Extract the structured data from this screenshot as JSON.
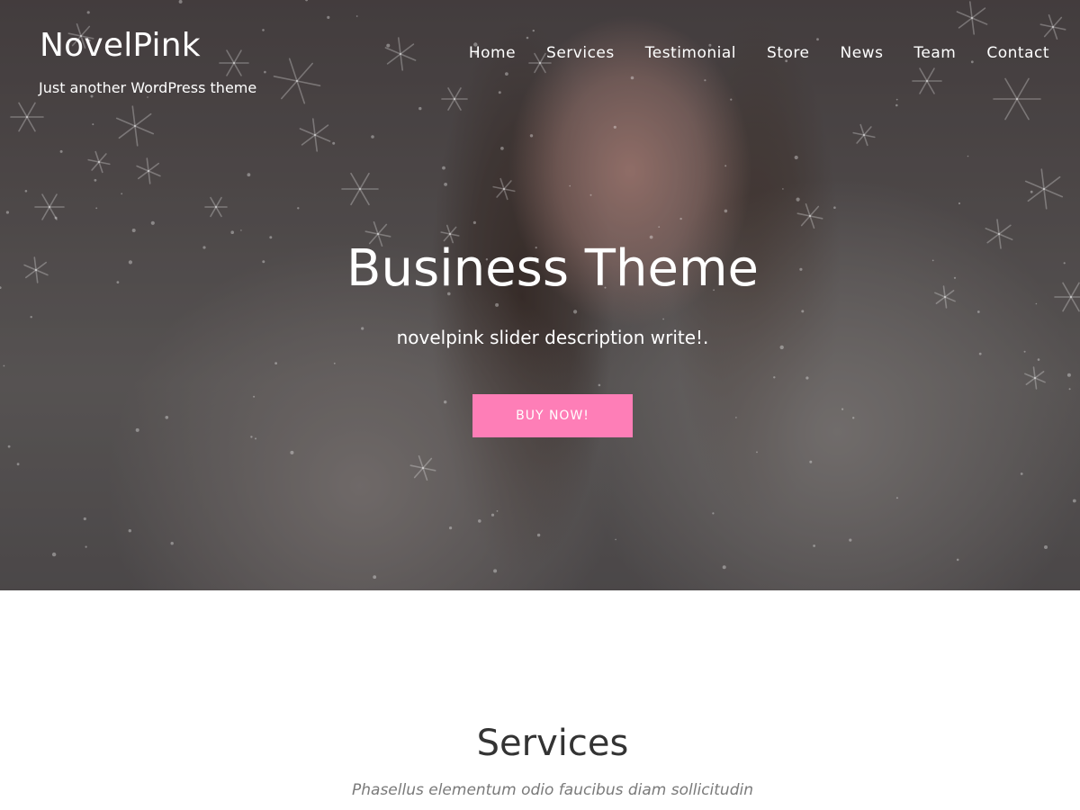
{
  "site": {
    "title": "NovelPink",
    "tagline": "Just another WordPress theme"
  },
  "nav": {
    "items": [
      {
        "label": "Home"
      },
      {
        "label": "Services"
      },
      {
        "label": "Testimonial"
      },
      {
        "label": "Store"
      },
      {
        "label": "News"
      },
      {
        "label": "Team"
      },
      {
        "label": "Contact"
      }
    ]
  },
  "hero": {
    "title": "Business Theme",
    "description": "novelpink slider description write!.",
    "button_label": "BUY NOW!",
    "button_color": "#fe7eb7",
    "image": "smiling woman in white fur coat with snowflakes"
  },
  "services": {
    "title": "Services",
    "subtitle": "Phasellus elementum odio faucibus diam sollicitudin"
  },
  "colors": {
    "accent": "#fe7eb7",
    "heading": "#333333",
    "muted": "#7a7a7a"
  }
}
